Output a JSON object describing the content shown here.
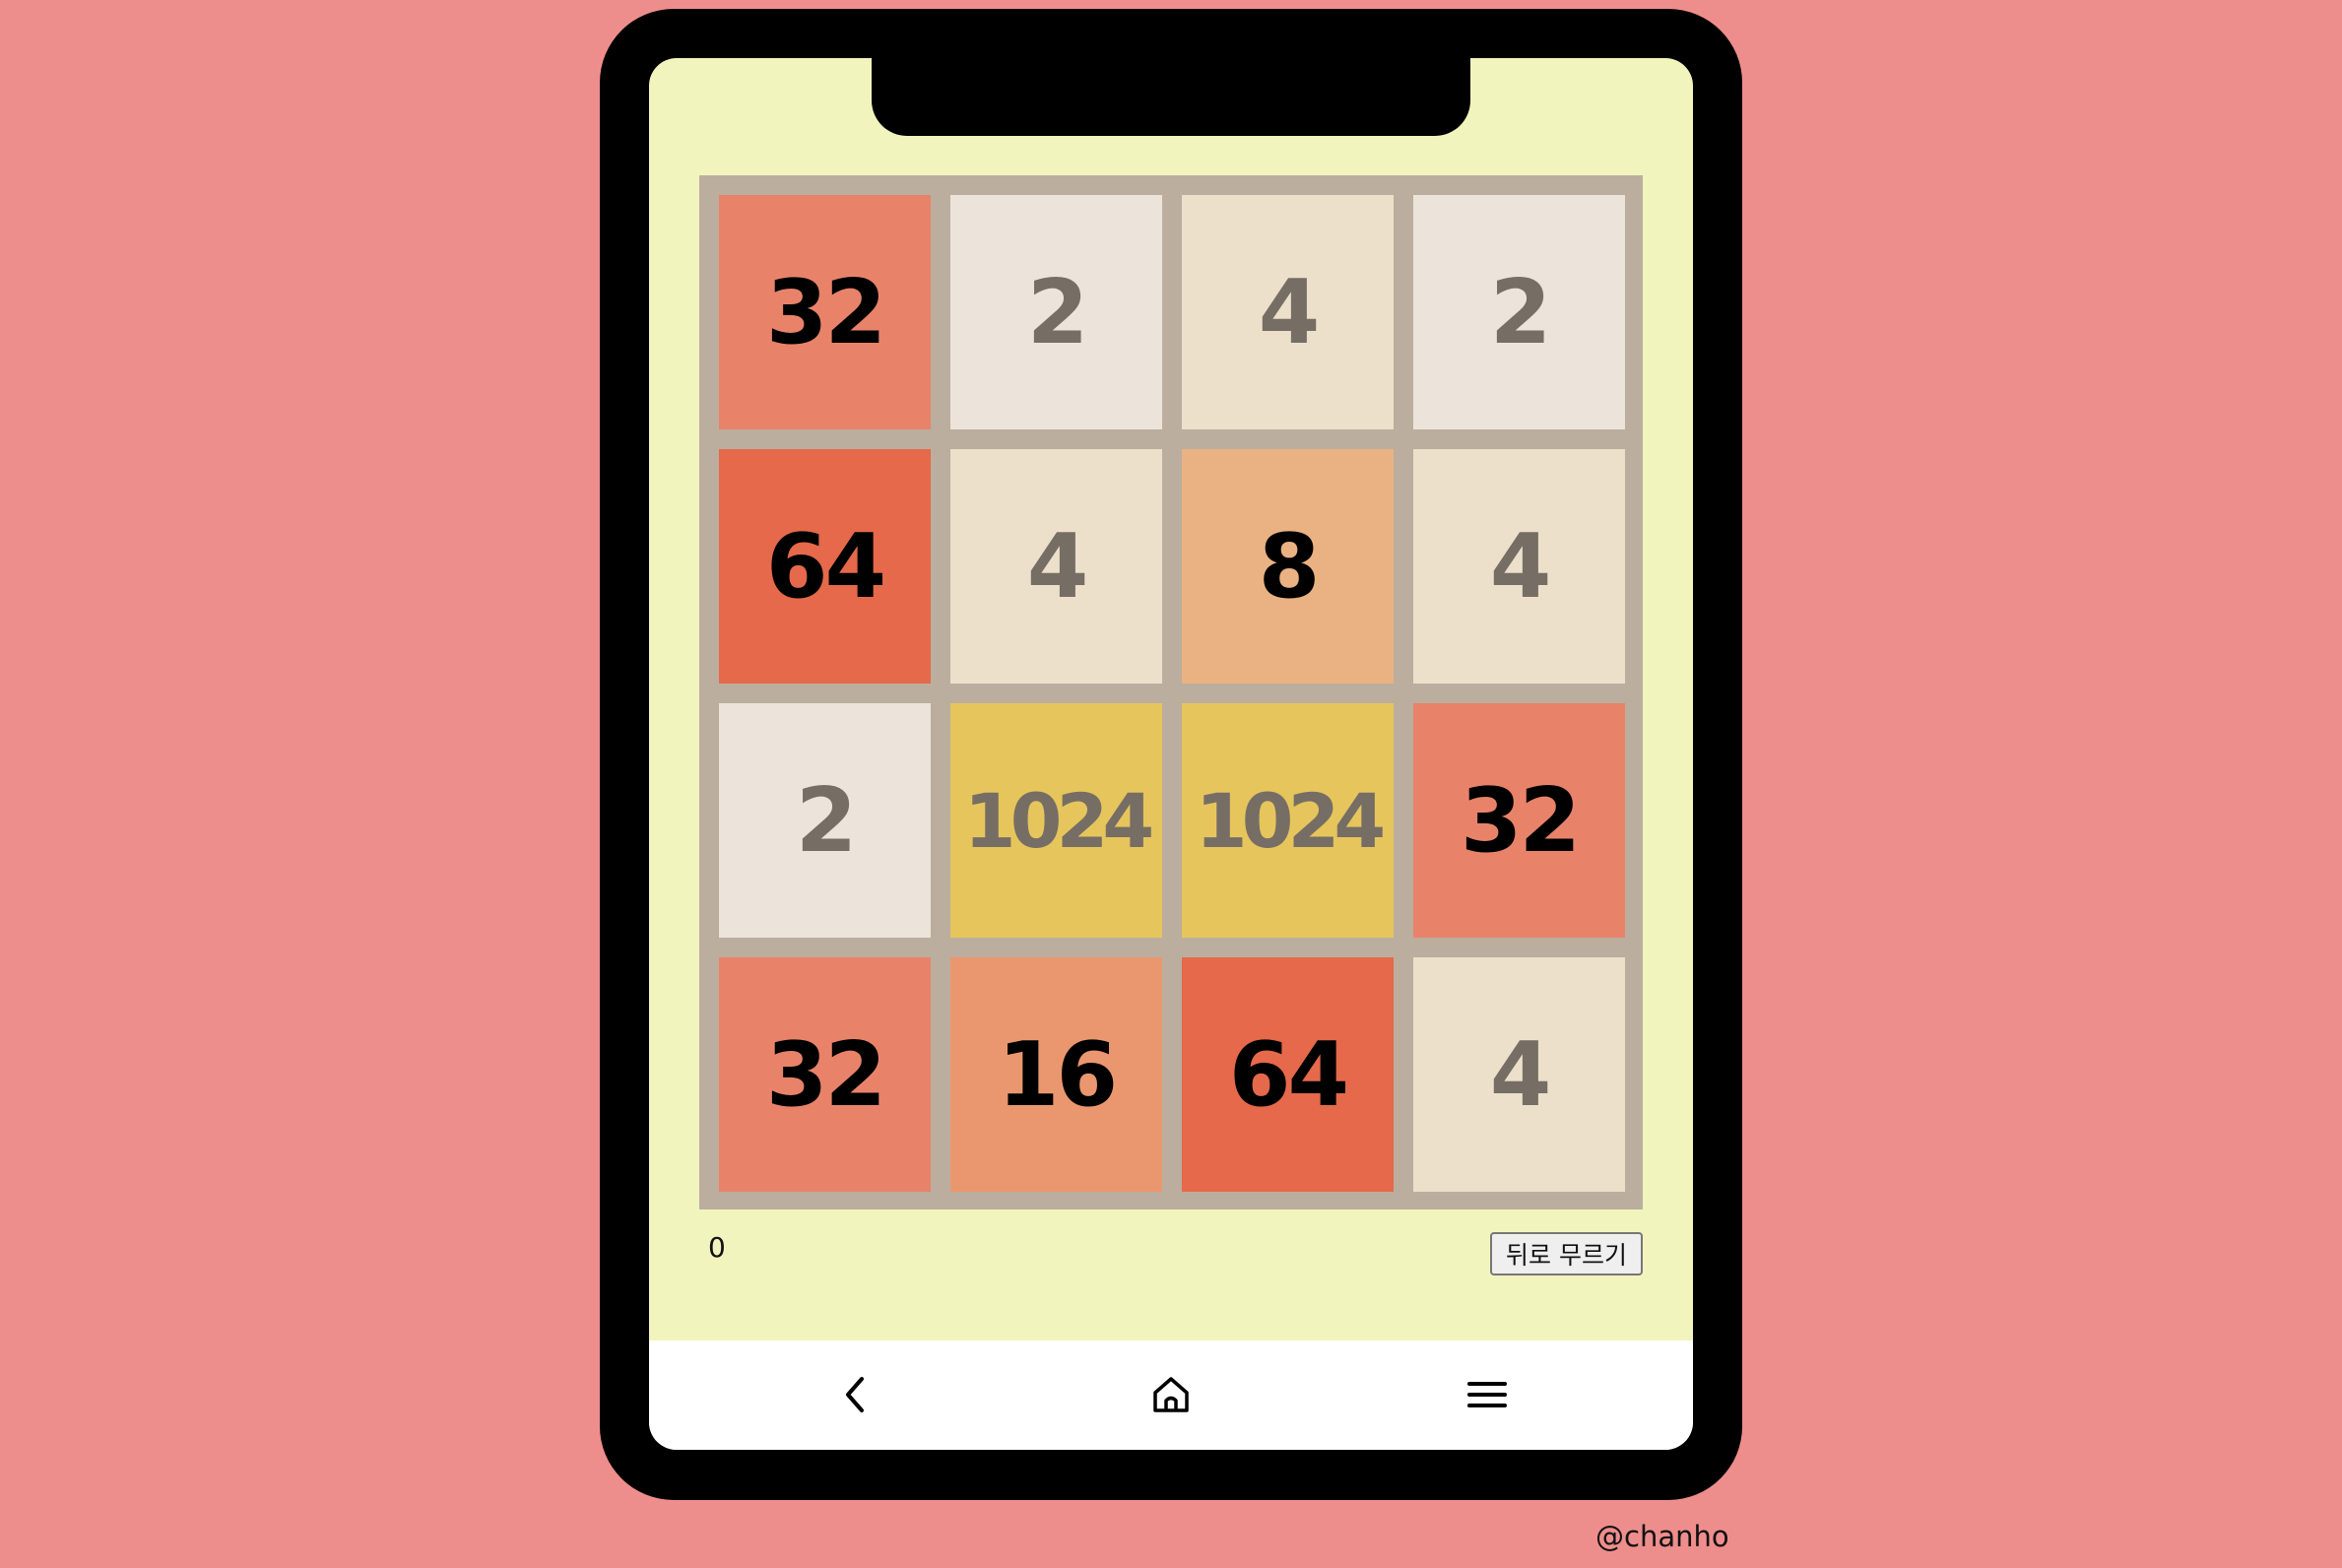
{
  "board": {
    "tiles": [
      {
        "value": "32",
        "bg": "#e8836a",
        "color": "#000000"
      },
      {
        "value": "2",
        "bg": "#ece4db",
        "color": "#766e65"
      },
      {
        "value": "4",
        "bg": "#ece0cb",
        "color": "#766e65"
      },
      {
        "value": "2",
        "bg": "#ece4db",
        "color": "#766e65"
      },
      {
        "value": "64",
        "bg": "#e5694a",
        "color": "#000000"
      },
      {
        "value": "4",
        "bg": "#ece0cb",
        "color": "#766e65"
      },
      {
        "value": "8",
        "bg": "#eab282",
        "color": "#000000"
      },
      {
        "value": "4",
        "bg": "#ece0cb",
        "color": "#766e65"
      },
      {
        "value": "2",
        "bg": "#ece4db",
        "color": "#766e65"
      },
      {
        "value": "1024",
        "bg": "#e6c55c",
        "color": "#766e65"
      },
      {
        "value": "1024",
        "bg": "#e6c55c",
        "color": "#766e65"
      },
      {
        "value": "32",
        "bg": "#e8836a",
        "color": "#000000"
      },
      {
        "value": "32",
        "bg": "#e8836a",
        "color": "#000000"
      },
      {
        "value": "16",
        "bg": "#ea976f",
        "color": "#000000"
      },
      {
        "value": "64",
        "bg": "#e5694a",
        "color": "#000000"
      },
      {
        "value": "4",
        "bg": "#ece0cb",
        "color": "#766e65"
      }
    ]
  },
  "footer": {
    "score": "0",
    "undo_label": "뒤로 무르기"
  },
  "navbar": {
    "back_icon": "chevron-left",
    "home_icon": "home",
    "menu_icon": "hamburger"
  },
  "credit": "@chanho",
  "colors": {
    "background": "#ee8e8c",
    "screen": "#f2f4bd",
    "board": "#bbae9e"
  }
}
